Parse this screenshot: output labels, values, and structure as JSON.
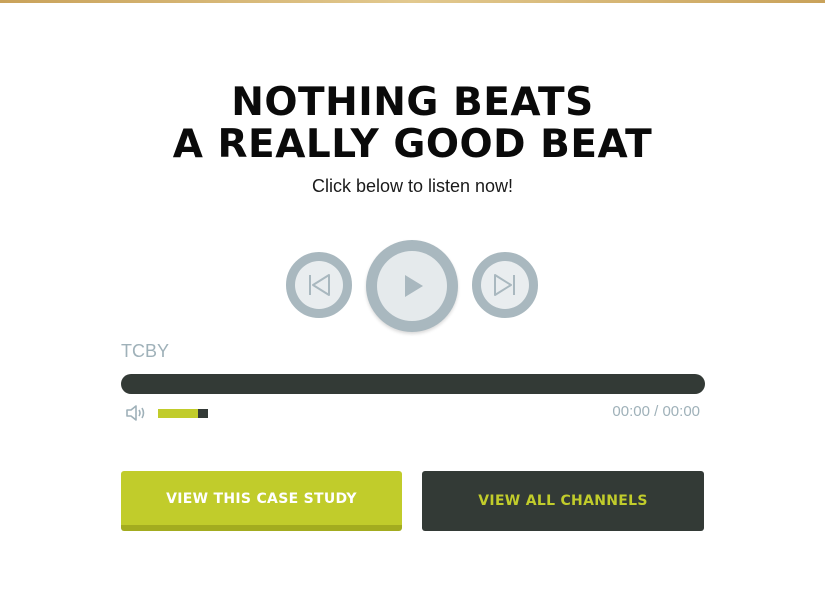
{
  "headline": {
    "line1": "NOTHING BEATS",
    "line2": "A REALLY GOOD BEAT"
  },
  "subhead": "Click below to listen now!",
  "player": {
    "controls": {
      "prev_icon": "skip-back-icon",
      "play_icon": "play-icon",
      "next_icon": "skip-forward-icon"
    },
    "track_name": "TCBY",
    "progress": 0,
    "volume_icon": "speaker-icon",
    "volume_level": 0.8,
    "time": "00:00 / 00:00"
  },
  "buttons": {
    "case_study": "VIEW THIS CASE STUDY",
    "all_channels": "VIEW ALL CHANNELS"
  },
  "colors": {
    "accent_green": "#c1cc2b",
    "dark": "#333a36",
    "control_gray": "#a9b8bf",
    "muted_text": "#9fb1b9",
    "top_border": "#c9a25a"
  }
}
